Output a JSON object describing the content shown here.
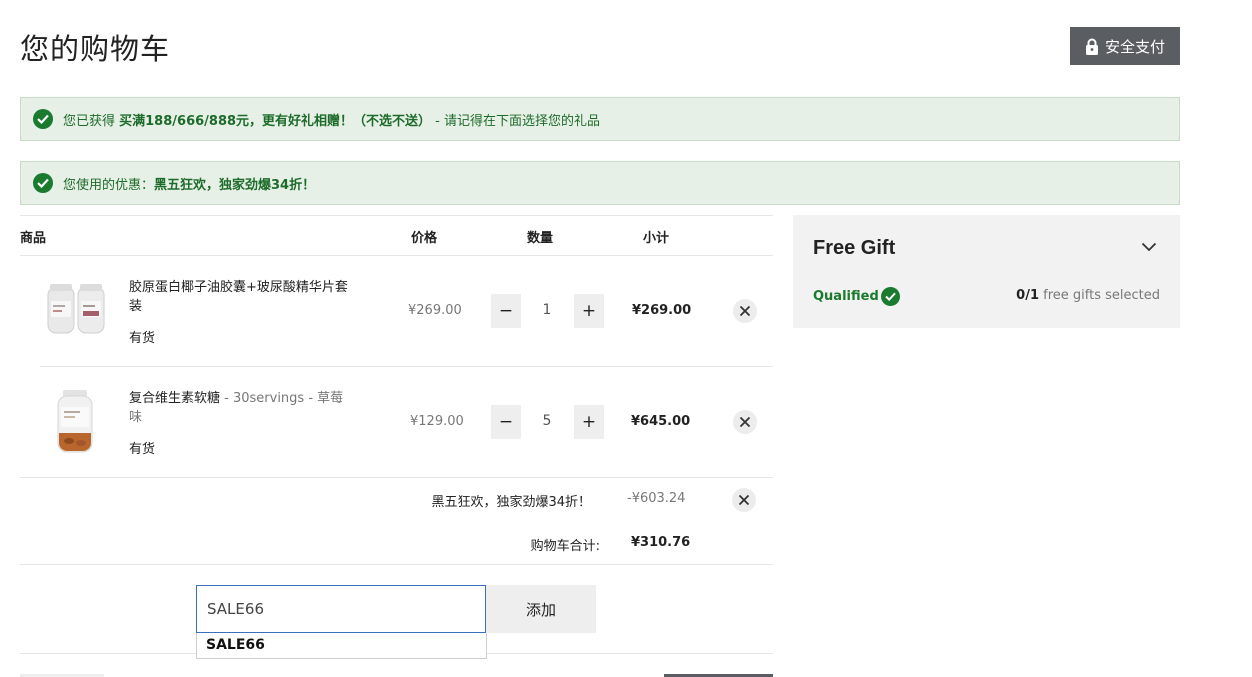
{
  "page": {
    "title": "您的购物车"
  },
  "secure_button": {
    "label": "安全支付",
    "icon": "lock-icon"
  },
  "notices": [
    {
      "prefix": "您已获得 ",
      "highlight": "买满188/666/888元，更有好礼相赠！（不选不送）",
      "suffix": " - 请记得在下面选择您的礼品"
    },
    {
      "prefix": "您使用的优惠：",
      "highlight": "黑五狂欢，独家劲爆34折！",
      "suffix": ""
    }
  ],
  "table": {
    "headers": {
      "product": "商品",
      "price": "价格",
      "quantity": "数量",
      "subtotal": "小计"
    }
  },
  "items": [
    {
      "name": "胶原蛋白椰子油胶囊+玻尿酸精华片套装",
      "variant": "",
      "stock": "有货",
      "price": "¥269.00",
      "quantity": "1",
      "subtotal": "¥269.00"
    },
    {
      "name": "复合维生素软糖",
      "variant": " - 30servings - 草莓味",
      "stock": "有货",
      "price": "¥129.00",
      "quantity": "5",
      "subtotal": "¥645.00"
    }
  ],
  "quantity_controls": {
    "minus": "−",
    "plus": "+"
  },
  "discount": {
    "label": "黑五狂欢，独家劲爆34折！",
    "amount": "-¥603.24"
  },
  "total": {
    "label": "购物车合计:",
    "amount": "¥310.76"
  },
  "coupon": {
    "value": "SALE66",
    "add_label": "添加",
    "suggestion": "SALE66"
  },
  "free_gift": {
    "title": "Free Gift",
    "qualified_label": "Qualified",
    "selected_count": "0",
    "max": "/1",
    "selected_text": " free gifts selected"
  },
  "colors": {
    "accent_green": "#1a7a2e",
    "notice_bg": "#e6f0e6",
    "dark_button": "#5a5d62"
  }
}
